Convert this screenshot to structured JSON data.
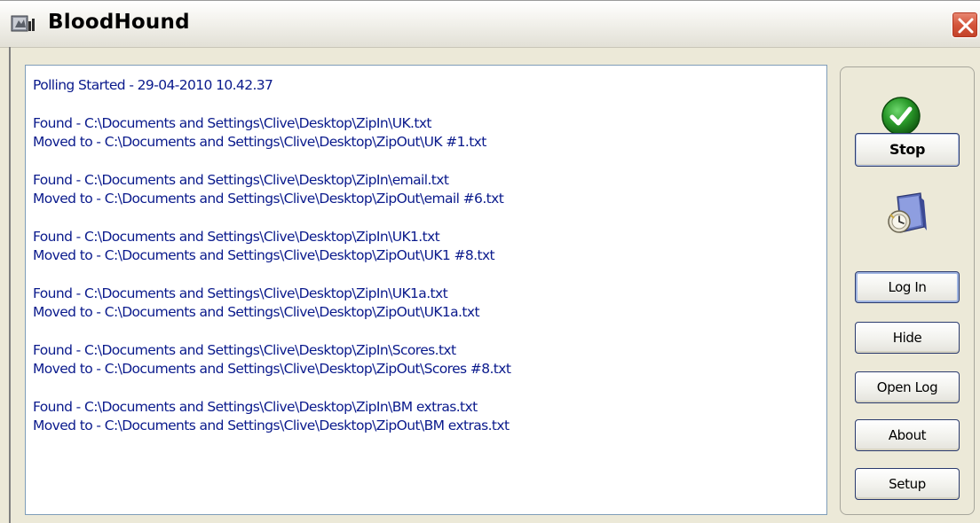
{
  "window": {
    "title": "BloodHound"
  },
  "log": {
    "header": "Polling Started  - 29-04-2010  10.42.37",
    "entries": [
      {
        "found": "Found - C:\\Documents and Settings\\Clive\\Desktop\\ZipIn\\UK.txt",
        "moved": "Moved to - C:\\Documents and Settings\\Clive\\Desktop\\ZipOut\\UK #1.txt"
      },
      {
        "found": "Found - C:\\Documents and Settings\\Clive\\Desktop\\ZipIn\\email.txt",
        "moved": "Moved to - C:\\Documents and Settings\\Clive\\Desktop\\ZipOut\\email #6.txt"
      },
      {
        "found": "Found - C:\\Documents and Settings\\Clive\\Desktop\\ZipIn\\UK1.txt",
        "moved": "Moved to - C:\\Documents and Settings\\Clive\\Desktop\\ZipOut\\UK1 #8.txt"
      },
      {
        "found": "Found - C:\\Documents and Settings\\Clive\\Desktop\\ZipIn\\UK1a.txt",
        "moved": "Moved to - C:\\Documents and Settings\\Clive\\Desktop\\ZipOut\\UK1a.txt"
      },
      {
        "found": "Found - C:\\Documents and Settings\\Clive\\Desktop\\ZipIn\\Scores.txt",
        "moved": "Moved to - C:\\Documents and Settings\\Clive\\Desktop\\ZipOut\\Scores #8.txt"
      },
      {
        "found": "Found - C:\\Documents and Settings\\Clive\\Desktop\\ZipIn\\BM extras.txt",
        "moved": "Moved to - C:\\Documents and Settings\\Clive\\Desktop\\ZipOut\\BM extras.txt"
      }
    ],
    "text_color": "#0a1a8c"
  },
  "side_panel": {
    "status_icon": "green-checkmark-icon",
    "status_color": "#2a9a2a",
    "stop_label": "Stop",
    "folder_icon": "folder-clock-icon",
    "login_label": "Log In",
    "hide_label": "Hide",
    "openlog_label": "Open Log",
    "about_label": "About",
    "setup_label": "Setup"
  },
  "icons": {
    "app": "bloodhound-app-icon",
    "close": "close-icon"
  }
}
